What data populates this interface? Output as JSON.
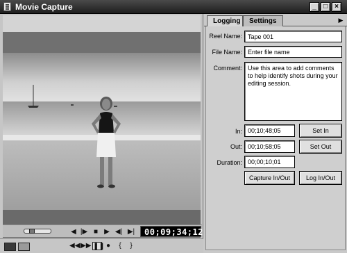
{
  "window": {
    "title": "Movie Capture",
    "controls": [
      "minimize-icon",
      "maximize-icon",
      "close-icon"
    ],
    "control_glyphs": {
      "minimize": "_",
      "maximize": "□",
      "close": "×"
    }
  },
  "player": {
    "timecode": "00;09;34;12",
    "transport_icons": [
      "jog-slider",
      "step-back-icon",
      "step-forward-icon",
      "stop-icon",
      "play-icon",
      "play-in-to-out-icon",
      "play-around-icon"
    ],
    "transport_glyphs": [
      "◀",
      "|▶",
      "■",
      "▶",
      "◀|",
      "▶|"
    ],
    "bottom_glyphs": [
      "◀◀",
      "▶▶",
      "❚❚",
      "●",
      "{",
      "}"
    ],
    "bottom_icons": [
      "rewind-icon",
      "fast-forward-icon",
      "pause-icon",
      "record-icon",
      "mark-in-icon",
      "mark-out-icon"
    ]
  },
  "tabs": [
    {
      "label": "Logging",
      "active": true
    },
    {
      "label": "Settings",
      "active": false
    }
  ],
  "tab_menu_glyph": "▶",
  "logging": {
    "reel_name_label": "Reel Name:",
    "reel_name_value": "Tape 001",
    "file_name_label": "File Name:",
    "file_name_value": "Enter file name",
    "comment_label": "Comment:",
    "comment_value": "Use this area to add comments to help identify shots during your editing session.",
    "in_label": "In:",
    "in_value": "00;10;48;05",
    "set_in_label": "Set In",
    "out_label": "Out:",
    "out_value": "00;10;58;05",
    "set_out_label": "Set Out",
    "duration_label": "Duration:",
    "duration_value": "00;00;10;01",
    "capture_label": "Capture In/Out",
    "log_label": "Log In/Out"
  }
}
